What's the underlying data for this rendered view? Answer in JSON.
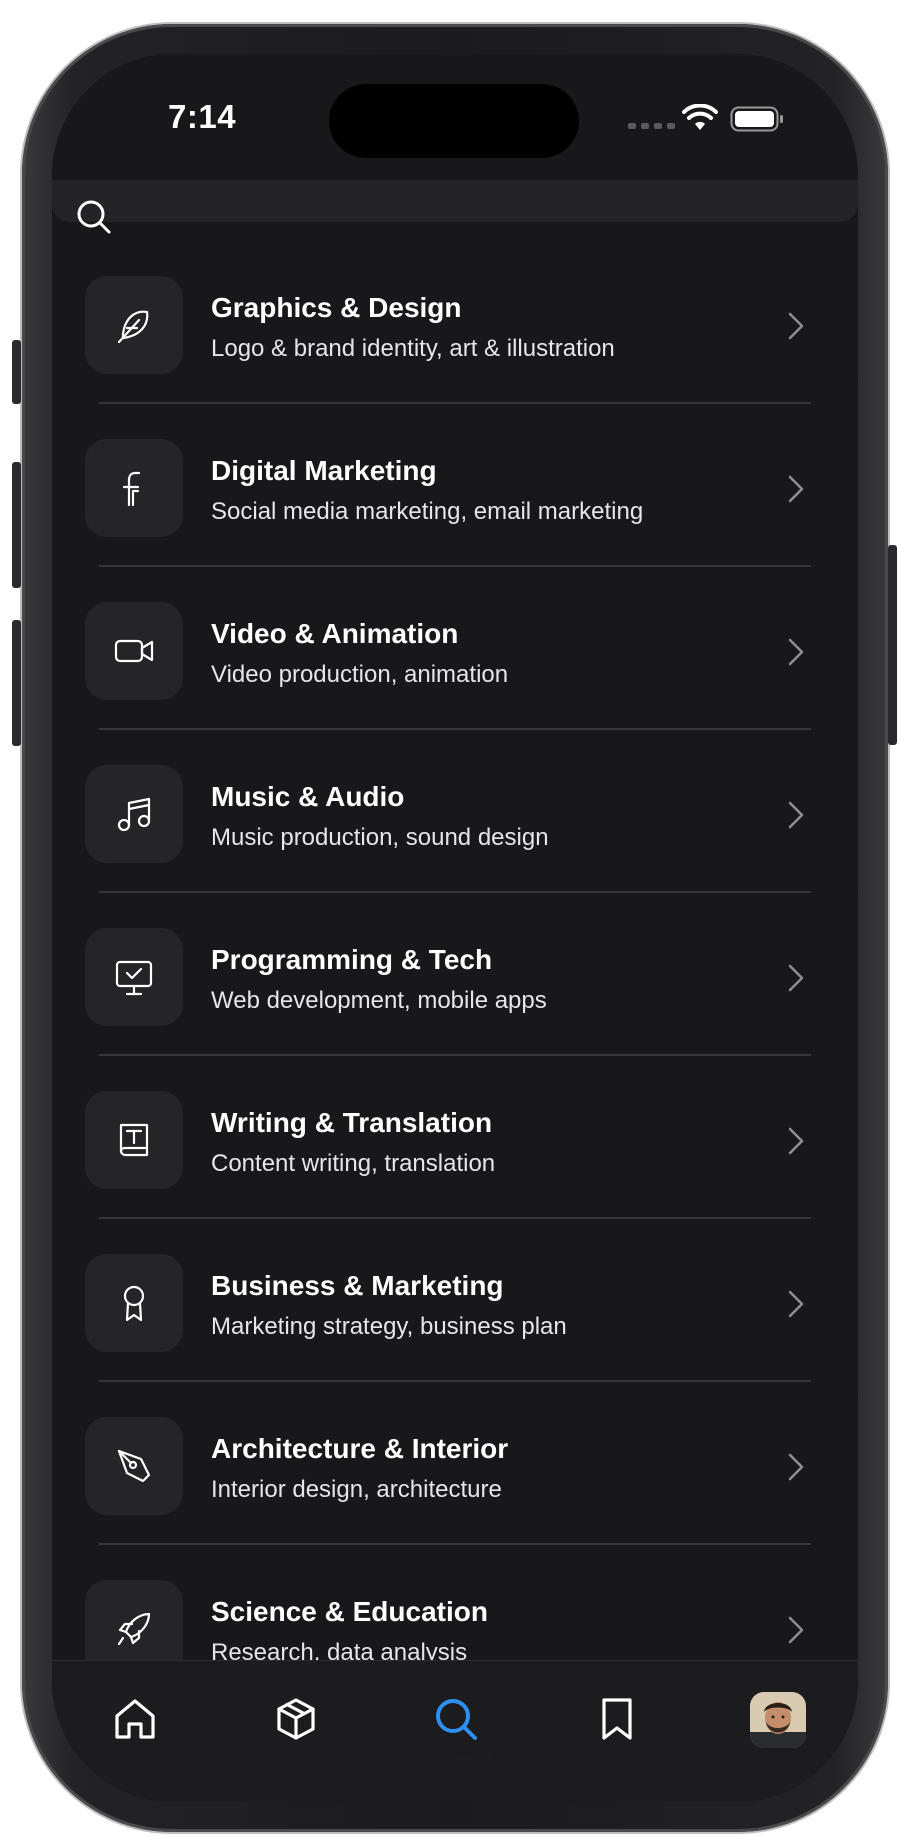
{
  "status_bar": {
    "time": "7:14"
  },
  "search": {
    "placeholder": ""
  },
  "categories": [
    {
      "title": "Graphics & Design",
      "subtitle": "Logo & brand identity, art & illustration",
      "icon": "feather-icon"
    },
    {
      "title": "Digital Marketing",
      "subtitle": "Social media marketing, email marketing",
      "icon": "facebook-icon"
    },
    {
      "title": "Video & Animation",
      "subtitle": "Video production, animation",
      "icon": "video-camera-icon"
    },
    {
      "title": "Music & Audio",
      "subtitle": "Music production, sound design",
      "icon": "music-note-icon"
    },
    {
      "title": "Programming & Tech",
      "subtitle": "Web development, mobile apps",
      "icon": "monitor-check-icon"
    },
    {
      "title": "Writing & Translation",
      "subtitle": "Content writing, translation",
      "icon": "text-book-icon"
    },
    {
      "title": "Business & Marketing",
      "subtitle": "Marketing strategy, business plan",
      "icon": "award-ribbon-icon"
    },
    {
      "title": "Architecture & Interior",
      "subtitle": "Interior design, architecture",
      "icon": "pen-tool-icon"
    },
    {
      "title": "Science & Education",
      "subtitle": "Research, data analysis",
      "icon": "rocket-icon"
    }
  ],
  "tab_bar": {
    "tabs": [
      "home-icon",
      "box-icon",
      "search-icon",
      "bookmark-icon",
      "avatar"
    ],
    "active_label": "Search",
    "active_color": "#2f8ff0"
  },
  "colors": {
    "background": "#18181a",
    "tile": "#252527",
    "text": "#ffffff",
    "chevron": "#8e8e93"
  }
}
